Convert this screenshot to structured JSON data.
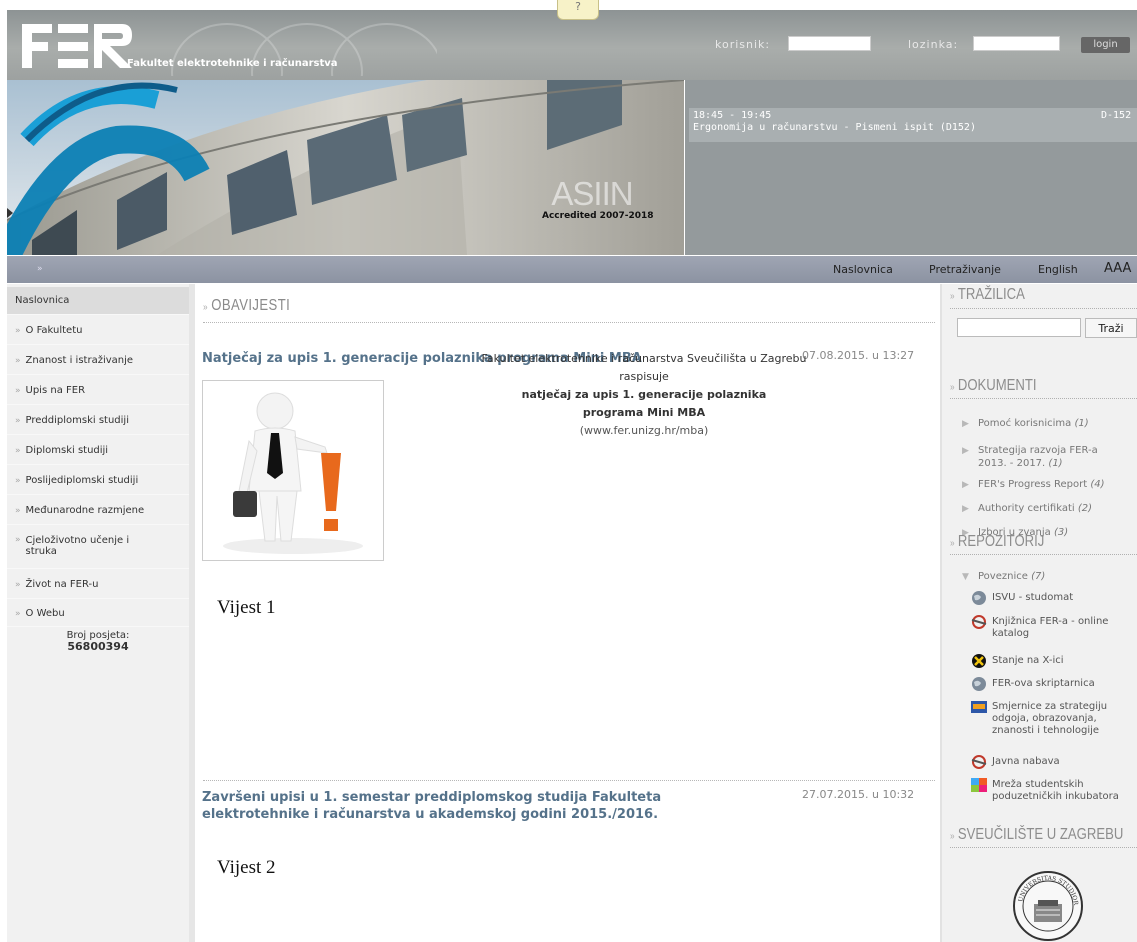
{
  "header": {
    "logo_text": "FER",
    "logo_subtitle": "Fakultet elektrotehnike i računarstva",
    "user_label": "korisnik:",
    "password_label": "lozinka:",
    "login_button": "login",
    "help_tab": "?"
  },
  "banner": {
    "asiin": "ASIIN",
    "accredited": "Accredited 2007-2018"
  },
  "events": {
    "time": "18:45 - 19:45",
    "room": "D-152",
    "title": "Ergonomija u računarstvu - Pismeni ispit (D152)"
  },
  "topnav": [
    "Naslovnica",
    "Pretraživanje",
    "English",
    "AAA"
  ],
  "leftnav": [
    "Naslovnica",
    "O Fakultetu",
    "Znanost i istraživanje",
    "Upis na FER",
    "Preddiplomski studiji",
    "Diplomski studiji",
    "Poslijediplomski studiji",
    "Međunarodne razmjene",
    "Cjeloživotno učenje i struka",
    "Život na FER-u",
    "O Webu"
  ],
  "visits": {
    "label": "Broj posjeta:",
    "count": "56800394"
  },
  "main": {
    "section_title": "OBAVIJESTI",
    "news": [
      {
        "title": "Natječaj za upis 1. generacije polaznika programa Mini MBA",
        "date": "07.08.2015. u 13:27",
        "line1": "Fakultet elektrotehnike i računarstva Sveučilišta u Zagrebu",
        "line2": "raspisuje",
        "bold1": "natječaj za upis 1. generacije polaznika",
        "bold2": "programa Mini MBA",
        "link": "(www.fer.unizg.hr/mba)",
        "label": "Vijest 1"
      },
      {
        "title_line1": "Završeni upisi u 1. semestar preddiplomskog studija Fakulteta",
        "title_line2": "elektrotehnike i računarstva u akademskoj godini 2015./2016.",
        "date": "27.07.2015. u 10:32",
        "label": "Vijest 2"
      }
    ]
  },
  "right": {
    "search_title": "TRAŽILICA",
    "search_button": "Traži",
    "documents_title": "DOKUMENTI",
    "documents": [
      {
        "line1": "Pomoć korisnicima",
        "line2": "",
        "count": "(1)"
      },
      {
        "line1": "Strategija razvoja FER-a",
        "line2": "2013. - 2017.",
        "count": "(1)"
      },
      {
        "line1": "FER's Progress Report",
        "line2": "",
        "count": "(4)"
      },
      {
        "line1": "Authority certifikati",
        "line2": "",
        "count": "(2)"
      },
      {
        "line1": "Izbori u zvanja",
        "line2": "",
        "count": "(3)"
      }
    ],
    "repo_title": "REPOZITORIJ",
    "links_header": "Poveznice",
    "links_count": "(7)",
    "links": [
      {
        "icon": "globe-icon",
        "lines": [
          "ISVU - studomat"
        ]
      },
      {
        "icon": "library-icon",
        "lines": [
          "Knjižnica FER-a - online",
          "katalog"
        ]
      },
      {
        "icon": "x-status-icon",
        "lines": [
          "Stanje na X-ici"
        ]
      },
      {
        "icon": "globe-icon",
        "lines": [
          "FER-ova skriptarnica"
        ]
      },
      {
        "icon": "strategy-icon",
        "lines": [
          "Smjernice za strategiju",
          "odgoja, obrazovanja,",
          "znanosti i tehnologije"
        ]
      },
      {
        "icon": "library-icon",
        "lines": [
          "Javna nabava"
        ]
      },
      {
        "icon": "incubator-icon",
        "lines": [
          "Mreža studentskih",
          "poduzetničkih inkubatora"
        ]
      }
    ],
    "univ_title": "SVEUČILIŠTE U ZAGREBU",
    "seal_text": "UNIVERSITAS STUDIORUM ZAGRABIENSIS"
  },
  "colors": {
    "title_blue": "#55728a",
    "nav_bar": "#959cab",
    "header_grey": "#9da1a0"
  }
}
